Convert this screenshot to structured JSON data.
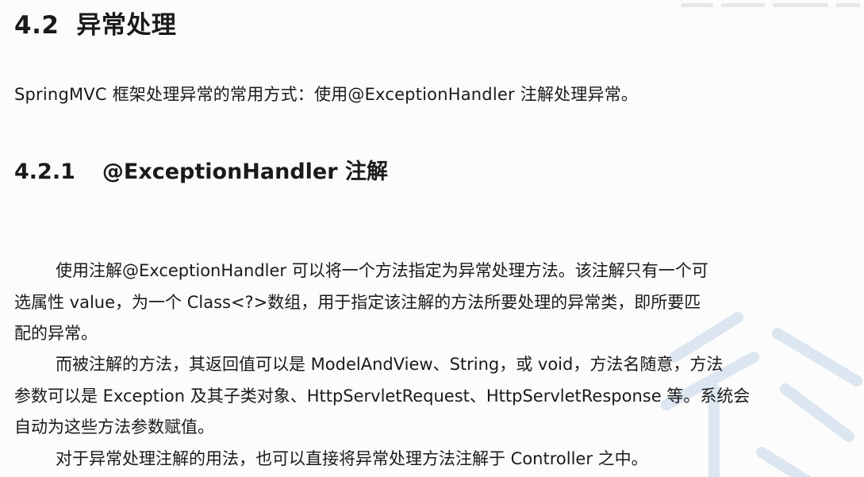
{
  "section": {
    "number": "4.2",
    "title": "异常处理"
  },
  "intro": "SpringMVC 框架处理异常的常用方式：使用@ExceptionHandler 注解处理异常。",
  "subsection": {
    "number": "4.2.1",
    "title": "@ExceptionHandler 注解"
  },
  "paragraphs": [
    {
      "lines": [
        "使用注解@ExceptionHandler  可以将一个方法指定为异常处理方法。该注解只有一个可",
        "选属性  value，为一个  Class<?>数组，用于指定该注解的方法所要处理的异常类，即所要匹",
        "配的异常。"
      ]
    },
    {
      "lines": [
        "而被注解的方法，其返回值可以是 ModelAndView、String，或 void，方法名随意，方法",
        "参数可以是  Exception  及其子类对象、HttpServletRequest、HttpServletResponse 等。系统会",
        "自动为这些方法参数赋值。"
      ]
    },
    {
      "lines": [
        "对于异常处理注解的用法，也可以直接将异常处理方法注解于 Controller 之中。"
      ]
    }
  ]
}
